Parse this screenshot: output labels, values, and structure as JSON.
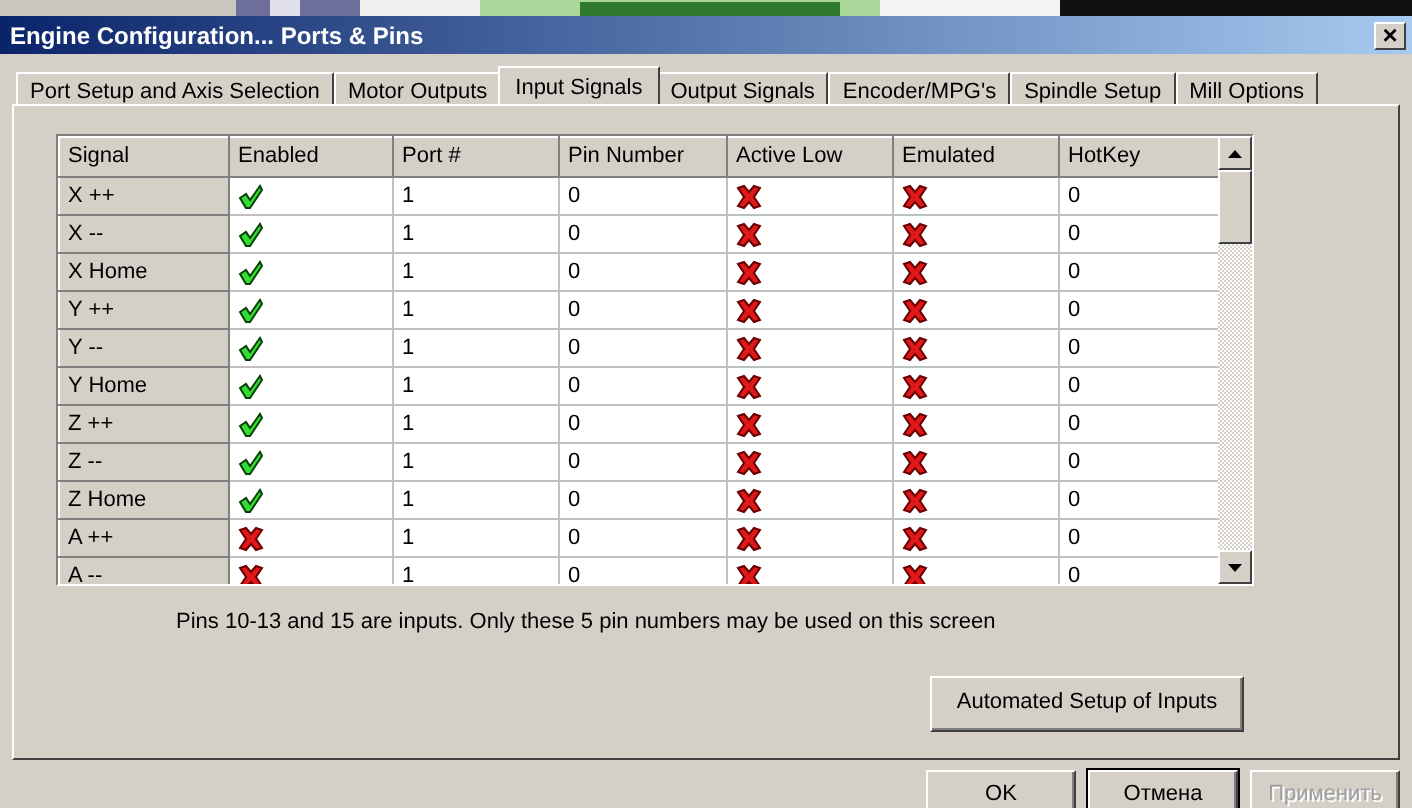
{
  "window": {
    "title": "Engine Configuration... Ports & Pins",
    "close": "×"
  },
  "tabs": [
    {
      "label": "Port Setup and Axis Selection",
      "selected": false
    },
    {
      "label": "Motor Outputs",
      "selected": false
    },
    {
      "label": "Input Signals",
      "selected": true
    },
    {
      "label": "Output Signals",
      "selected": false
    },
    {
      "label": "Encoder/MPG's",
      "selected": false
    },
    {
      "label": "Spindle Setup",
      "selected": false
    },
    {
      "label": "Mill Options",
      "selected": false
    }
  ],
  "table": {
    "columns": [
      "Signal",
      "Enabled",
      "Port #",
      "Pin Number",
      "Active Low",
      "Emulated",
      "HotKey"
    ],
    "rows": [
      {
        "signal": "X ++",
        "enabled": true,
        "port": "1",
        "pin": "0",
        "active_low": false,
        "emulated": false,
        "hotkey": "0"
      },
      {
        "signal": "X --",
        "enabled": true,
        "port": "1",
        "pin": "0",
        "active_low": false,
        "emulated": false,
        "hotkey": "0"
      },
      {
        "signal": "X Home",
        "enabled": true,
        "port": "1",
        "pin": "0",
        "active_low": false,
        "emulated": false,
        "hotkey": "0"
      },
      {
        "signal": "Y ++",
        "enabled": true,
        "port": "1",
        "pin": "0",
        "active_low": false,
        "emulated": false,
        "hotkey": "0"
      },
      {
        "signal": "Y --",
        "enabled": true,
        "port": "1",
        "pin": "0",
        "active_low": false,
        "emulated": false,
        "hotkey": "0"
      },
      {
        "signal": "Y Home",
        "enabled": true,
        "port": "1",
        "pin": "0",
        "active_low": false,
        "emulated": false,
        "hotkey": "0"
      },
      {
        "signal": "Z ++",
        "enabled": true,
        "port": "1",
        "pin": "0",
        "active_low": false,
        "emulated": false,
        "hotkey": "0"
      },
      {
        "signal": "Z --",
        "enabled": true,
        "port": "1",
        "pin": "0",
        "active_low": false,
        "emulated": false,
        "hotkey": "0"
      },
      {
        "signal": "Z Home",
        "enabled": true,
        "port": "1",
        "pin": "0",
        "active_low": false,
        "emulated": false,
        "hotkey": "0"
      },
      {
        "signal": "A ++",
        "enabled": false,
        "port": "1",
        "pin": "0",
        "active_low": false,
        "emulated": false,
        "hotkey": "0"
      },
      {
        "signal": "A --",
        "enabled": false,
        "port": "1",
        "pin": "0",
        "active_low": false,
        "emulated": false,
        "hotkey": "0"
      }
    ]
  },
  "note": "Pins 10-13 and 15 are inputs. Only these 5 pin numbers may be used on this screen",
  "setup_button": "Automated Setup of Inputs",
  "buttons": [
    {
      "label": "OK",
      "disabled": false,
      "default": false
    },
    {
      "label": "Отмена",
      "disabled": false,
      "default": true
    },
    {
      "label": "Применить",
      "disabled": true,
      "default": false
    }
  ]
}
